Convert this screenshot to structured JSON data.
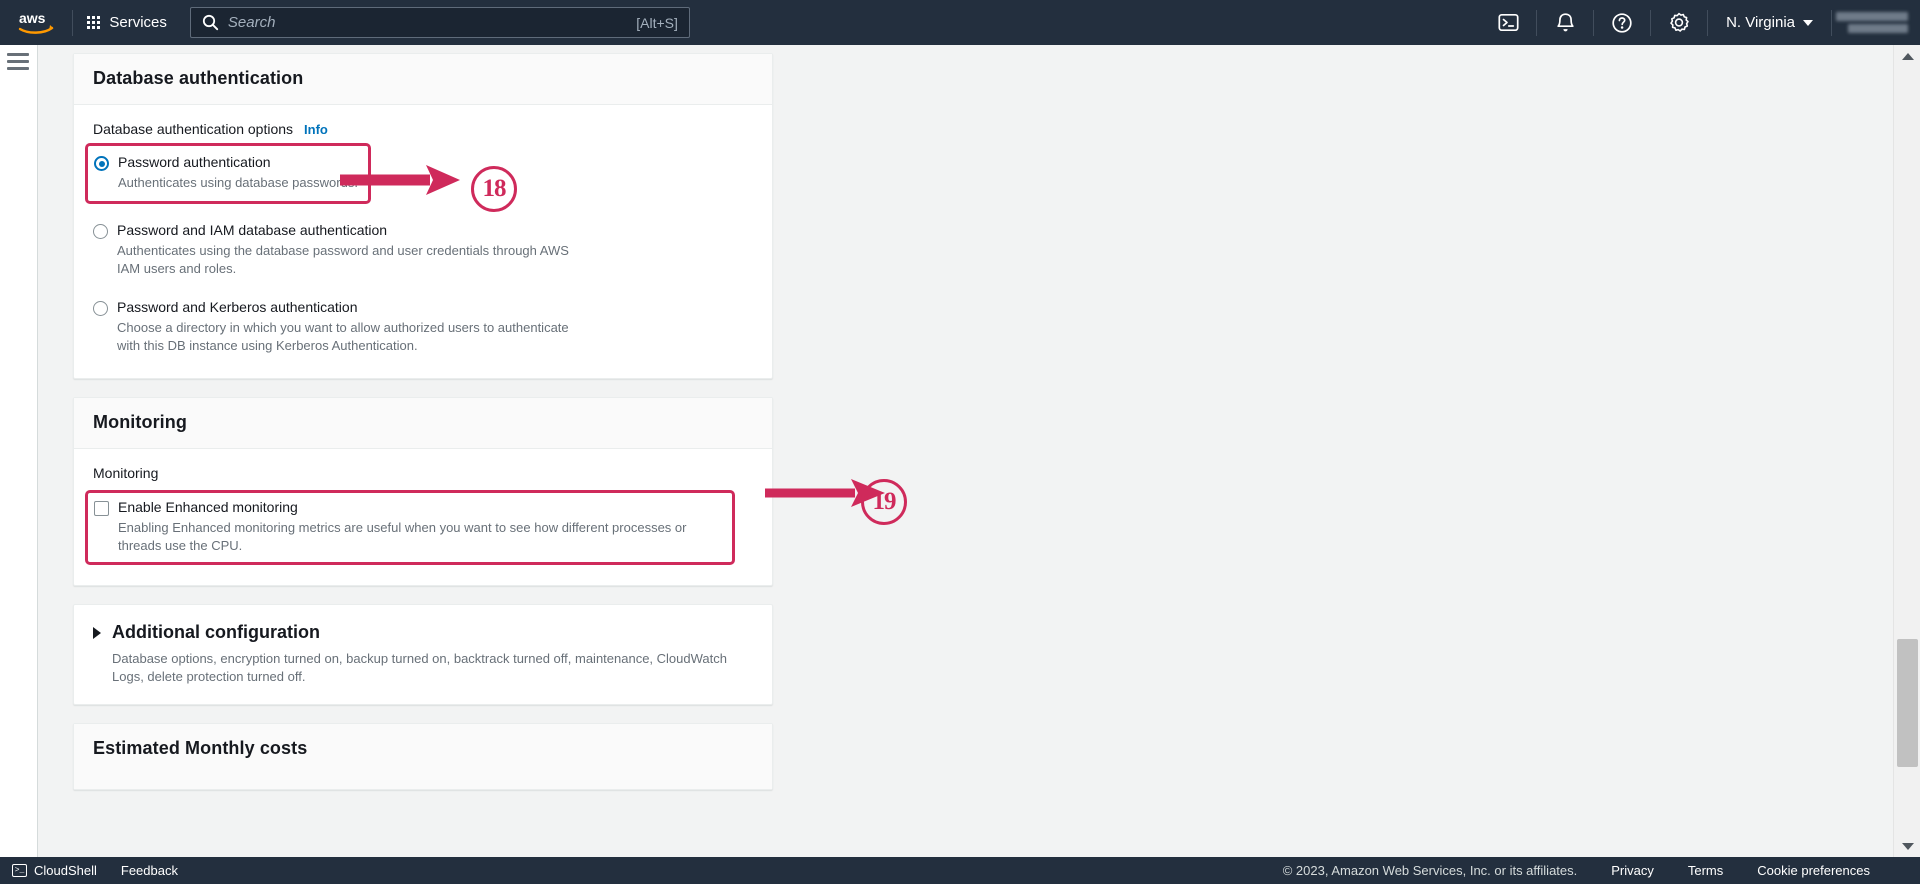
{
  "topnav": {
    "logo_alt": "aws",
    "services_label": "Services",
    "search_placeholder": "Search",
    "search_value": "",
    "search_shortcut": "[Alt+S]",
    "region_label": "N. Virginia",
    "icons": {
      "cloudshell": "cloudshell-icon",
      "notifications": "bell-icon",
      "help": "help-icon",
      "settings": "gear-icon"
    }
  },
  "sidebar": {
    "toggle_label": "menu-toggle"
  },
  "sections": {
    "database_authentication": {
      "title": "Database authentication",
      "options_label": "Database authentication options",
      "info_label": "Info",
      "options": [
        {
          "title": "Password authentication",
          "desc": "Authenticates using database passwords.",
          "selected": true
        },
        {
          "title": "Password and IAM database authentication",
          "desc": "Authenticates using the database password and user credentials through AWS IAM users and roles.",
          "selected": false
        },
        {
          "title": "Password and Kerberos authentication",
          "desc": "Choose a directory in which you want to allow authorized users to authenticate with this DB instance using Kerberos Authentication.",
          "selected": false
        }
      ]
    },
    "monitoring": {
      "title": "Monitoring",
      "sub_label": "Monitoring",
      "checkbox": {
        "title": "Enable Enhanced monitoring",
        "desc": "Enabling Enhanced monitoring metrics are useful when you want to see how different processes or threads use the CPU.",
        "checked": false
      }
    },
    "additional_configuration": {
      "title": "Additional configuration",
      "desc": "Database options, encryption turned on, backup turned on, backtrack turned off, maintenance, CloudWatch Logs, delete protection turned off.",
      "expanded": false
    },
    "estimated_costs": {
      "title": "Estimated Monthly costs"
    }
  },
  "annotations": {
    "accent_color": "#cf2a5b",
    "markers": [
      {
        "number": "18",
        "target": "Password authentication"
      },
      {
        "number": "19",
        "target": "Enable Enhanced monitoring"
      }
    ]
  },
  "footer": {
    "cloudshell_label": "CloudShell",
    "feedback_label": "Feedback",
    "copyright": "© 2023, Amazon Web Services, Inc. or its affiliates.",
    "links": [
      "Privacy",
      "Terms",
      "Cookie preferences"
    ]
  }
}
